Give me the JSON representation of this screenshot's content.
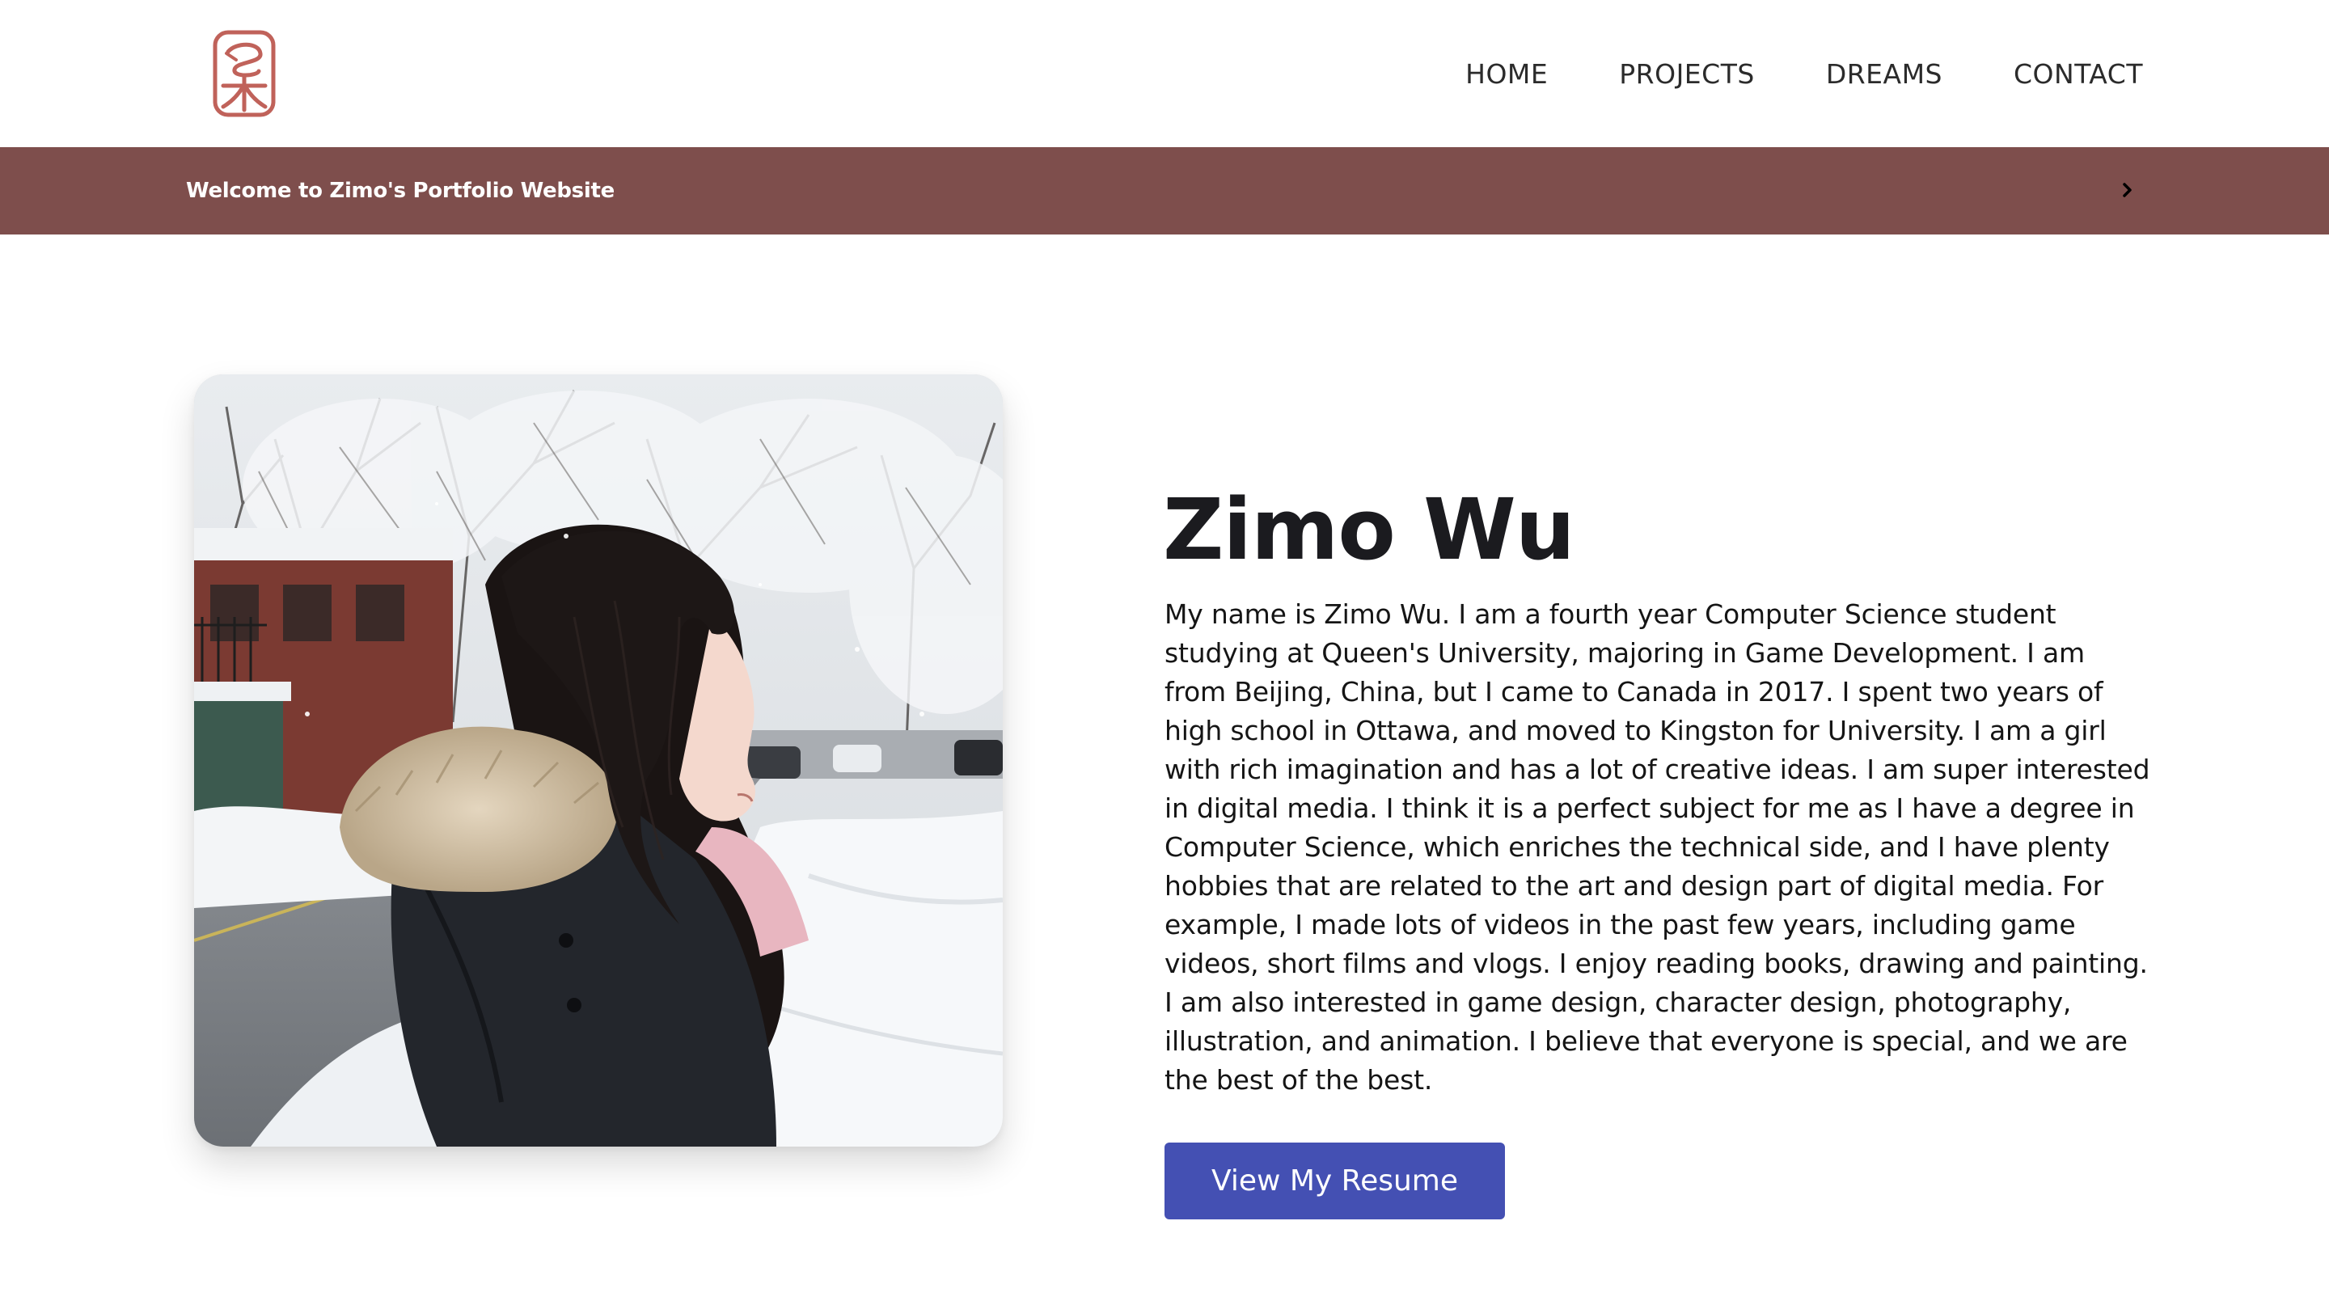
{
  "header": {
    "logo_name": "seal-logo",
    "nav": [
      {
        "label": "HOME"
      },
      {
        "label": "PROJECTS"
      },
      {
        "label": "DREAMS"
      },
      {
        "label": "CONTACT"
      }
    ]
  },
  "banner": {
    "text": "Welcome to Zimo's Portfolio Website",
    "arrow_icon": "chevron-right-icon",
    "color": "#7e4e4c"
  },
  "profile": {
    "photo_name": "profile-photo",
    "name": "Zimo Wu",
    "bio": "My name is Zimo Wu. I am a fourth year Computer Science student studying at Queen's University, majoring in Game Development. I am from Beijing, China, but I came to Canada in 2017. I spent two years of high school in Ottawa, and moved to Kingston for University. I am a girl with rich imagination and has a lot of creative ideas. I am super interested in digital media. I think it is a perfect subject for me as I have a degree in Computer Science, which enriches the technical side, and I have plenty hobbies that are related to the art and design part of digital media. For example, I made lots of videos in the past few years, including game videos, short films and vlogs. I enjoy reading books, drawing and painting. I am also interested in game design, character design, photography, illustration, and animation. I believe that everyone is special, and we are the best of the best.",
    "button_label": "View My Resume",
    "button_color": "#4450b3"
  }
}
